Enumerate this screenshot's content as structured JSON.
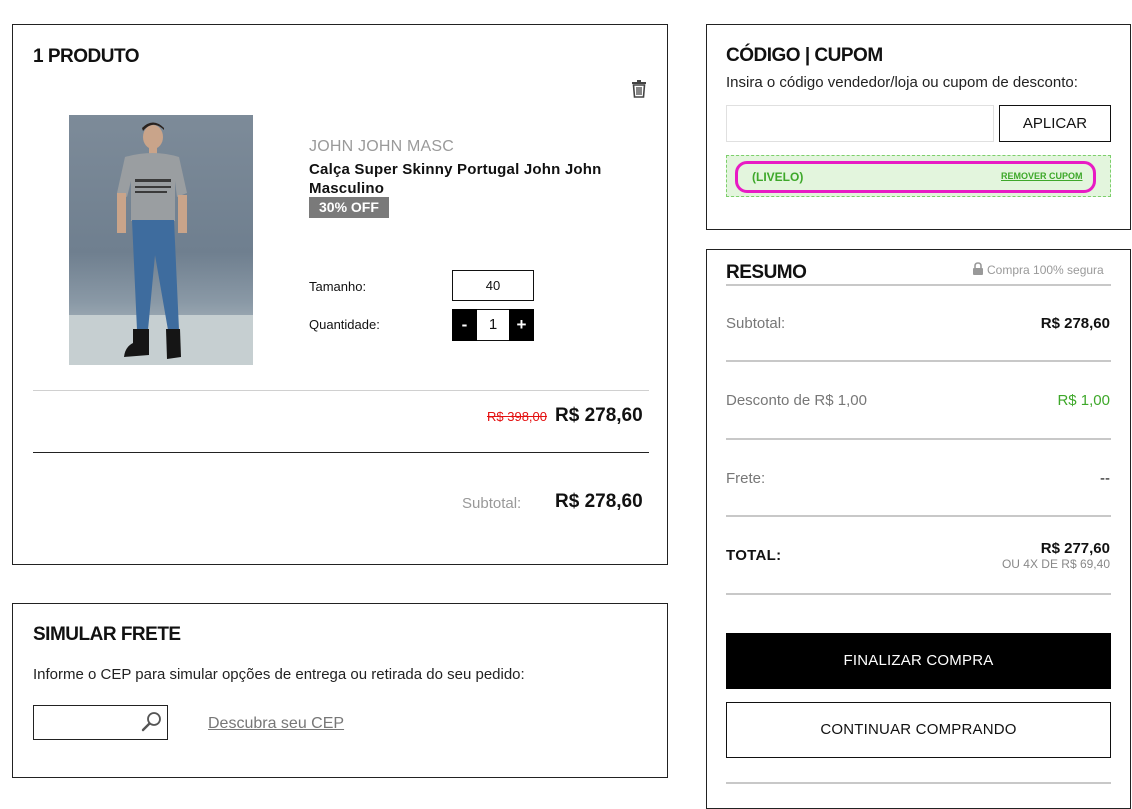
{
  "cart": {
    "title": "1 PRODUTO",
    "item": {
      "brand": "JOHN JOHN MASC",
      "name": "Calça Super Skinny Portugal John John Masculino",
      "discount_badge": "30% OFF",
      "size_label": "Tamanho:",
      "size_value": "40",
      "quantity_label": "Quantidade:",
      "quantity_minus": "-",
      "quantity_value": "1",
      "quantity_plus": "+",
      "old_price": "R$ 398,00",
      "price": "R$ 278,60"
    },
    "subtotal_label": "Subtotal:",
    "subtotal_value": "R$ 278,60"
  },
  "shipping_sim": {
    "title": "SIMULAR FRETE",
    "description": "Informe o CEP para simular opções de entrega ou retirada do seu pedido:",
    "cep_placeholder": "",
    "find_cep_link": "Descubra seu CEP"
  },
  "coupon": {
    "title": "CÓDIGO | CUPOM",
    "description": "Insira o código vendedor/loja ou cupom de desconto:",
    "input_value": "",
    "apply_button": "APLICAR",
    "applied_code": "(LIVELO)",
    "remove_link": "REMOVER CUPOM"
  },
  "summary": {
    "title": "RESUMO",
    "secure_text": "Compra 100% segura",
    "subtotal_label": "Subtotal:",
    "subtotal_value": "R$ 278,60",
    "discount_label": "Desconto de R$ 1,00",
    "discount_value": "R$ 1,00",
    "shipping_label": "Frete:",
    "shipping_value": "--",
    "total_label": "TOTAL:",
    "total_value": "R$ 277,60",
    "installments": "OU 4X DE R$ 69,40",
    "checkout_button": "FINALIZAR COMPRA",
    "continue_button": "CONTINUAR COMPRANDO"
  },
  "colors": {
    "accent_green": "#3ea82a",
    "highlight_ring": "#e81bc4",
    "old_price_red": "#e41010",
    "button_black": "#000000"
  },
  "icons": [
    "trash-icon",
    "search-icon",
    "lock-icon"
  ]
}
